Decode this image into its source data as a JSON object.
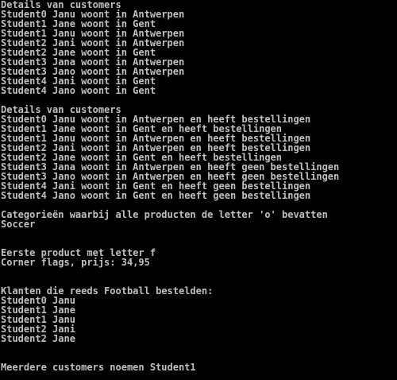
{
  "console": {
    "lines": [
      "Details van customers",
      "Student0 Janu woont in Antwerpen",
      "Student1 Jane woont in Gent",
      "Student1 Janu woont in Antwerpen",
      "Student2 Jani woont in Antwerpen",
      "Student2 Jane woont in Gent",
      "Student3 Jana woont in Antwerpen",
      "Student3 Jano woont in Antwerpen",
      "Student4 Jani woont in Gent",
      "Student4 Jano woont in Gent",
      "",
      "Details van customers",
      "Student0 Janu woont in Antwerpen en heeft bestellingen",
      "Student1 Jane woont in Gent en heeft bestellingen",
      "Student1 Janu woont in Antwerpen en heeft bestellingen",
      "Student2 Jani woont in Antwerpen en heeft bestellingen",
      "Student2 Jane woont in Gent en heeft bestellingen",
      "Student3 Jana woont in Antwerpen en heeft geen bestellingen",
      "Student3 Jano woont in Antwerpen en heeft geen bestellingen",
      "Student4 Jani woont in Gent en heeft geen bestellingen",
      "Student4 Jano woont in Gent en heeft geen bestellingen",
      "",
      "Categorieën waarbij alle producten de letter 'o' bevatten",
      "Soccer",
      "",
      "",
      "Eerste product met letter f",
      "Corner flags, prijs: 34,95",
      "",
      "",
      "Klanten die reeds Football bestelden:",
      "Student0 Janu",
      "Student1 Jane",
      "Student1 Janu",
      "Student2 Jani",
      "Student2 Jane",
      "",
      "",
      "Meerdere customers noemen Student1"
    ]
  }
}
